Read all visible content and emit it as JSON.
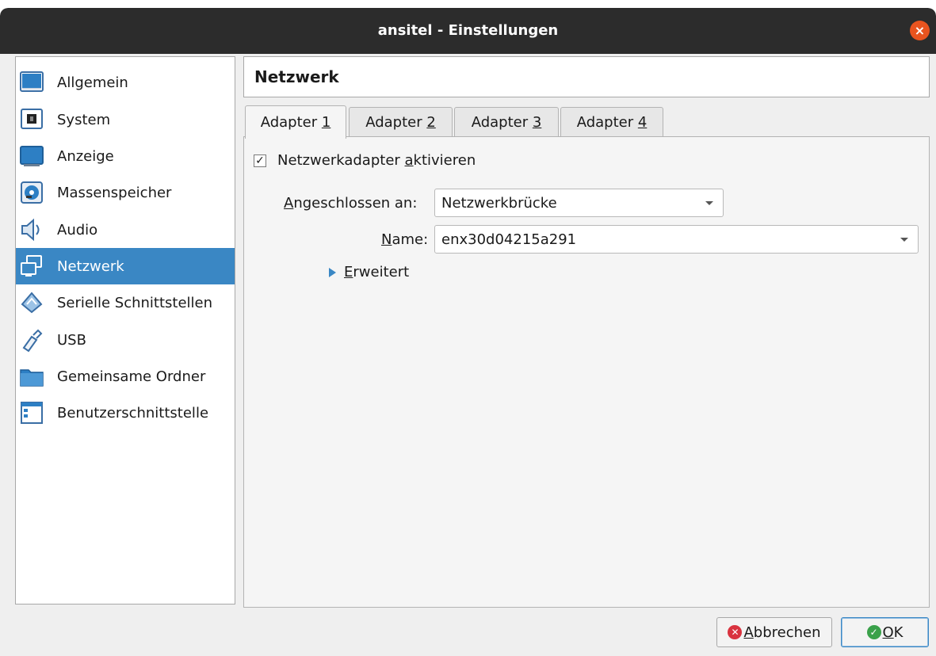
{
  "window": {
    "title": "ansitel - Einstellungen",
    "close_symbol": "×"
  },
  "sidebar": {
    "items": [
      {
        "label": "Allgemein",
        "icon": "general-icon"
      },
      {
        "label": "System",
        "icon": "system-icon"
      },
      {
        "label": "Anzeige",
        "icon": "display-icon"
      },
      {
        "label": "Massenspeicher",
        "icon": "storage-icon"
      },
      {
        "label": "Audio",
        "icon": "audio-icon"
      },
      {
        "label": "Netzwerk",
        "icon": "network-icon",
        "selected": true
      },
      {
        "label": "Serielle Schnittstellen",
        "icon": "serial-port-icon"
      },
      {
        "label": "USB",
        "icon": "usb-icon"
      },
      {
        "label": "Gemeinsame Ordner",
        "icon": "shared-folder-icon"
      },
      {
        "label": "Benutzerschnittstelle",
        "icon": "user-interface-icon"
      }
    ]
  },
  "main": {
    "heading": "Netzwerk",
    "tabs": [
      {
        "label": "Adapter ",
        "mnemonic": "1",
        "active": true
      },
      {
        "label": "Adapter ",
        "mnemonic": "2"
      },
      {
        "label": "Adapter ",
        "mnemonic": "3"
      },
      {
        "label": "Adapter ",
        "mnemonic": "4"
      }
    ],
    "enable_checkbox": {
      "label_pre": "Netzwerkadapter ",
      "mnemonic": "a",
      "label_post": "ktivieren",
      "checked": true,
      "check_glyph": "✓"
    },
    "attached_to": {
      "mnemonic": "A",
      "label_rest": "ngeschlossen an:",
      "value": "Netzwerkbrücke"
    },
    "name": {
      "mnemonic": "N",
      "label_rest": "ame:",
      "value": "enx30d04215a291"
    },
    "advanced": {
      "mnemonic": "E",
      "label_rest": "rweitert"
    }
  },
  "buttons": {
    "cancel": {
      "mnemonic": "A",
      "label_rest": "bbrechen",
      "icon_glyph": "✕",
      "color": "#d9333f"
    },
    "ok": {
      "mnemonic": "O",
      "label_rest": "K",
      "icon_glyph": "✓",
      "color": "#3aa14a"
    }
  },
  "colors": {
    "accent": "#3a87c4",
    "titlebar": "#2c2c2c",
    "close": "#e9541f"
  }
}
